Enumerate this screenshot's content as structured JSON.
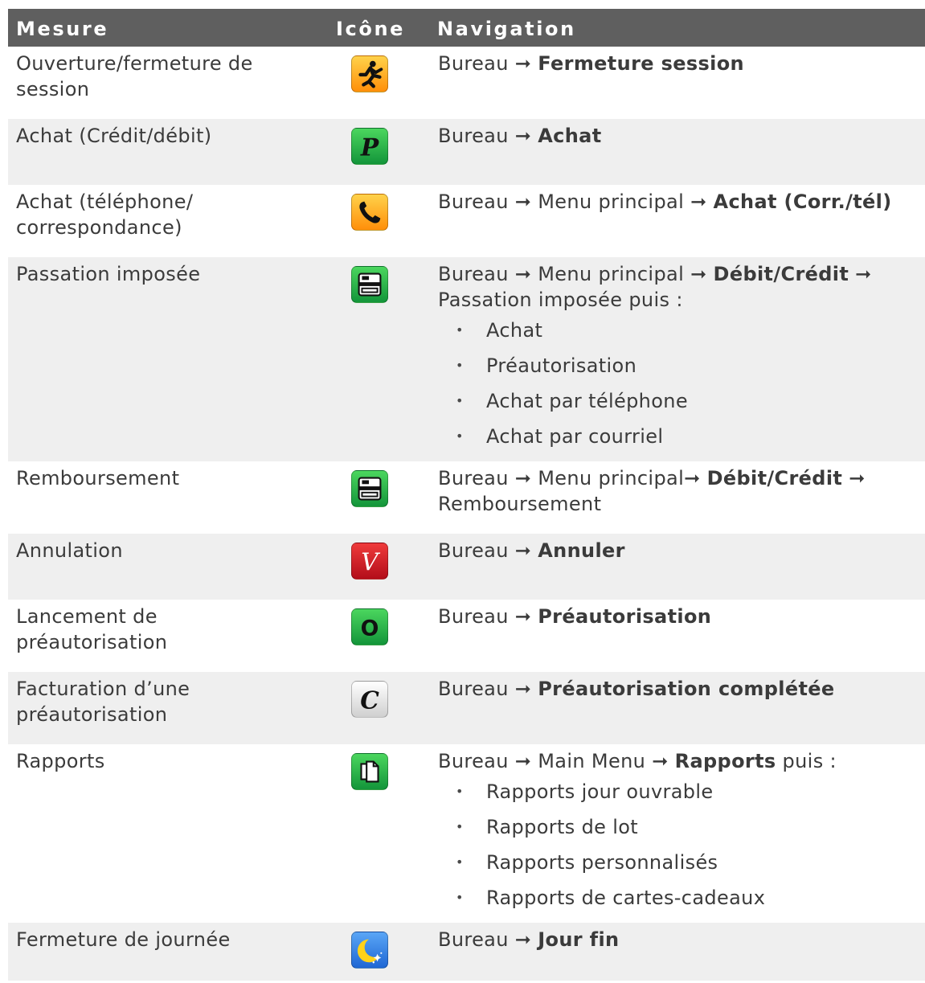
{
  "headers": {
    "mesure": "Mesure",
    "icone": "Icône",
    "navigation": "Navigation"
  },
  "rows": [
    {
      "mesure": "Ouverture/fermeture de session",
      "icon": "running-man-icon",
      "nav": [
        {
          "t": "Bureau ",
          "b": false
        },
        {
          "t": "➞ ",
          "b": false
        },
        {
          "t": "Fermeture session",
          "b": true
        }
      ],
      "bullets": []
    },
    {
      "mesure": "Achat (Crédit/débit)",
      "icon": "purchase-p-icon",
      "nav": [
        {
          "t": "Bureau ",
          "b": false
        },
        {
          "t": "➞ ",
          "b": false
        },
        {
          "t": "Achat",
          "b": true
        }
      ],
      "bullets": []
    },
    {
      "mesure": "Achat (téléphone/ correspondance)",
      "icon": "phone-icon",
      "nav": [
        {
          "t": "Bureau ",
          "b": false
        },
        {
          "t": "➞ ",
          "b": false
        },
        {
          "t": "Menu principal ",
          "b": false
        },
        {
          "t": "➞ ",
          "b": false
        },
        {
          "t": "Achat (Corr./tél)",
          "b": true
        }
      ],
      "bullets": []
    },
    {
      "mesure": "Passation imposée",
      "icon": "card-terminal-icon",
      "nav": [
        {
          "t": "Bureau ",
          "b": false
        },
        {
          "t": "➞ ",
          "b": false
        },
        {
          "t": "Menu principal ",
          "b": false
        },
        {
          "t": "➞ ",
          "b": false
        },
        {
          "t": "Débit/Crédit",
          "b": true
        },
        {
          "t": " ➞ Passation imposée puis :",
          "b": false
        }
      ],
      "bullets": [
        "Achat",
        "Préautorisation",
        "Achat par téléphone",
        "Achat par courriel"
      ]
    },
    {
      "mesure": "Remboursement",
      "icon": "card-terminal-icon",
      "nav": [
        {
          "t": "Bureau ",
          "b": false
        },
        {
          "t": "➞ ",
          "b": false
        },
        {
          "t": "Menu principal",
          "b": false
        },
        {
          "t": "➞ ",
          "b": false
        },
        {
          "t": "Débit/Crédit",
          "b": true
        },
        {
          "t": " ➞ Remboursement",
          "b": false
        }
      ],
      "bullets": []
    },
    {
      "mesure": "Annulation",
      "icon": "void-v-icon",
      "nav": [
        {
          "t": "Bureau ",
          "b": false
        },
        {
          "t": "➞ ",
          "b": false
        },
        {
          "t": "Annuler",
          "b": true
        }
      ],
      "bullets": []
    },
    {
      "mesure": "Lancement de préautorisation",
      "icon": "preauth-o-icon",
      "nav": [
        {
          "t": "Bureau ",
          "b": false
        },
        {
          "t": "➞ ",
          "b": false
        },
        {
          "t": "Préautorisation",
          "b": true
        }
      ],
      "bullets": []
    },
    {
      "mesure": "Facturation d’une préautorisation",
      "icon": "completion-c-icon",
      "nav": [
        {
          "t": "Bureau ",
          "b": false
        },
        {
          "t": "➞ ",
          "b": false
        },
        {
          "t": "Préautorisation complétée",
          "b": true
        }
      ],
      "bullets": []
    },
    {
      "mesure": "Rapports",
      "icon": "reports-icon",
      "nav": [
        {
          "t": "Bureau ",
          "b": false
        },
        {
          "t": "➞ ",
          "b": false
        },
        {
          "t": "Main Menu ",
          "b": false
        },
        {
          "t": "➞ ",
          "b": false
        },
        {
          "t": "Rapports",
          "b": true
        },
        {
          "t": " puis :",
          "b": false
        }
      ],
      "bullets": [
        "Rapports jour ouvrable",
        "Rapports de lot",
        "Rapports personnalisés",
        "Rapports de cartes-cadeaux"
      ]
    },
    {
      "mesure": "Fermeture de journée",
      "icon": "end-of-day-moon-icon",
      "nav": [
        {
          "t": "Bureau ",
          "b": false
        },
        {
          "t": "➞ ",
          "b": false
        },
        {
          "t": "Jour fin",
          "b": true
        }
      ],
      "bullets": []
    }
  ],
  "colors": {
    "header_bg": "#5f5f5f",
    "row_alt_bg": "#efefef",
    "text": "#3b3b3b"
  }
}
